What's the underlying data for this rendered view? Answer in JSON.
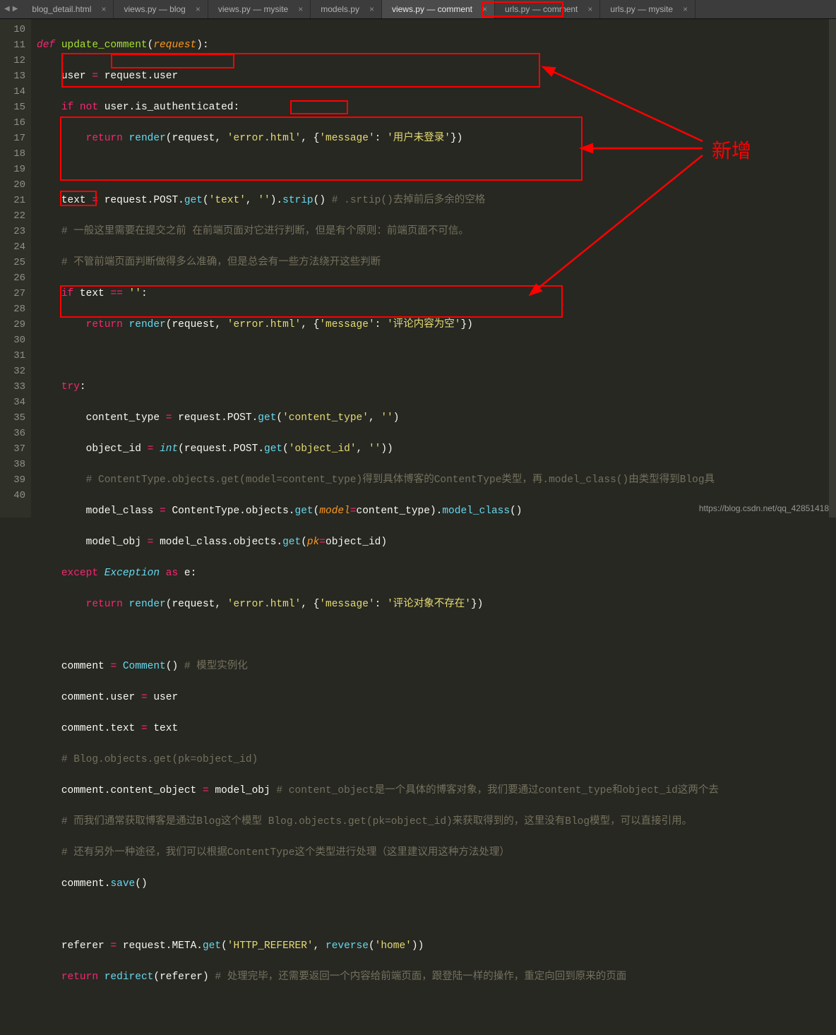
{
  "tabs": [
    {
      "label": "blog_detail.html",
      "active": false
    },
    {
      "label": "views.py — blog",
      "active": false
    },
    {
      "label": "views.py — mysite",
      "active": false
    },
    {
      "label": "models.py",
      "active": false
    },
    {
      "label": "views.py — comment",
      "active": true
    },
    {
      "label": "urls.py — comment",
      "active": false
    },
    {
      "label": "urls.py — mysite",
      "active": false
    }
  ],
  "line_start": 10,
  "line_end": 40,
  "code": {
    "l10": {
      "def": "def",
      "fn": "update_comment",
      "param": "request"
    },
    "l11": {
      "a": "user",
      "op": "=",
      "b": "request",
      "c": "user"
    },
    "l12": {
      "if": "if",
      "not": "not",
      "a": "user",
      "b": "is_authenticated"
    },
    "l13": {
      "ret": "return",
      "fn": "render",
      "a": "request",
      "s1": "'error.html'",
      "s2": "'message'",
      "s3": "'用户未登录'"
    },
    "l15": {
      "a": "text",
      "op": "=",
      "b": "request",
      "c": "POST",
      "fn1": "get",
      "s1": "'text'",
      "s2": "''",
      "fn2": "strip",
      "cmt": "# .srtip()去掉前后多余的空格"
    },
    "l16": {
      "cmt": "# 一般这里需要在提交之前 在前端页面对它进行判断，但是有个原则：前端页面不可信。"
    },
    "l17": {
      "cmt": "# 不管前端页面判断做得多么准确，但是总会有一些方法绕开这些判断"
    },
    "l18": {
      "if": "if",
      "a": "text",
      "op": "==",
      "s": "''"
    },
    "l19": {
      "ret": "return",
      "fn": "render",
      "a": "request",
      "s1": "'error.html'",
      "s2": "'message'",
      "s3": "'评论内容为空'"
    },
    "l21": {
      "try": "try"
    },
    "l22": {
      "a": "content_type",
      "op": "=",
      "b": "request",
      "c": "POST",
      "fn": "get",
      "s1": "'content_type'",
      "s2": "''"
    },
    "l23": {
      "a": "object_id",
      "op": "=",
      "int": "int",
      "b": "request",
      "c": "POST",
      "fn": "get",
      "s1": "'object_id'",
      "s2": "''"
    },
    "l24": {
      "cmt": "# ContentType.objects.get(model=content_type)得到具体博客的ContentType类型，再.model_class()由类型得到Blog具"
    },
    "l25": {
      "a": "model_class",
      "op": "=",
      "b": "ContentType",
      "c": "objects",
      "fn": "get",
      "kw": "model",
      "d": "content_type",
      "fn2": "model_class"
    },
    "l26": {
      "a": "model_obj",
      "op": "=",
      "b": "model_class",
      "c": "objects",
      "fn": "get",
      "kw": "pk",
      "d": "object_id"
    },
    "l27": {
      "except": "except",
      "exc": "Exception",
      "as": "as",
      "e": "e"
    },
    "l28": {
      "ret": "return",
      "fn": "render",
      "a": "request",
      "s1": "'error.html'",
      "s2": "'message'",
      "s3": "'评论对象不存在'"
    },
    "l30": {
      "a": "comment",
      "op": "=",
      "fn": "Comment",
      "cmt": "# 模型实例化"
    },
    "l31": {
      "a": "comment",
      "b": "user",
      "op": "=",
      "c": "user"
    },
    "l32": {
      "a": "comment",
      "b": "text",
      "op": "=",
      "c": "text"
    },
    "l33": {
      "cmt": "# Blog.objects.get(pk=object_id)"
    },
    "l34": {
      "a": "comment",
      "b": "content_object",
      "op": "=",
      "c": "model_obj",
      "cmt": "# content_object是一个具体的博客对象，我们要通过content_type和object_id这两个去"
    },
    "l35": {
      "cmt": "# 而我们通常获取博客是通过Blog这个模型 Blog.objects.get(pk=object_id)来获取得到的，这里没有Blog模型，可以直接引用。"
    },
    "l36": {
      "cmt": "# 还有另外一种途径，我们可以根据ContentType这个类型进行处理（这里建议用这种方法处理）"
    },
    "l37": {
      "a": "comment",
      "fn": "save"
    },
    "l39": {
      "a": "referer",
      "op": "=",
      "b": "request",
      "c": "META",
      "fn": "get",
      "s1": "'HTTP_REFERER'",
      "fn2": "reverse",
      "s2": "'home'"
    },
    "l40": {
      "ret": "return",
      "fn": "redirect",
      "a": "referer",
      "cmt": "# 处理完毕，还需要返回一个内容给前端页面，跟登陆一样的操作，重定向回到原来的页面"
    }
  },
  "annotation": "新增",
  "watermark": "https://blog.csdn.net/qq_42851418"
}
